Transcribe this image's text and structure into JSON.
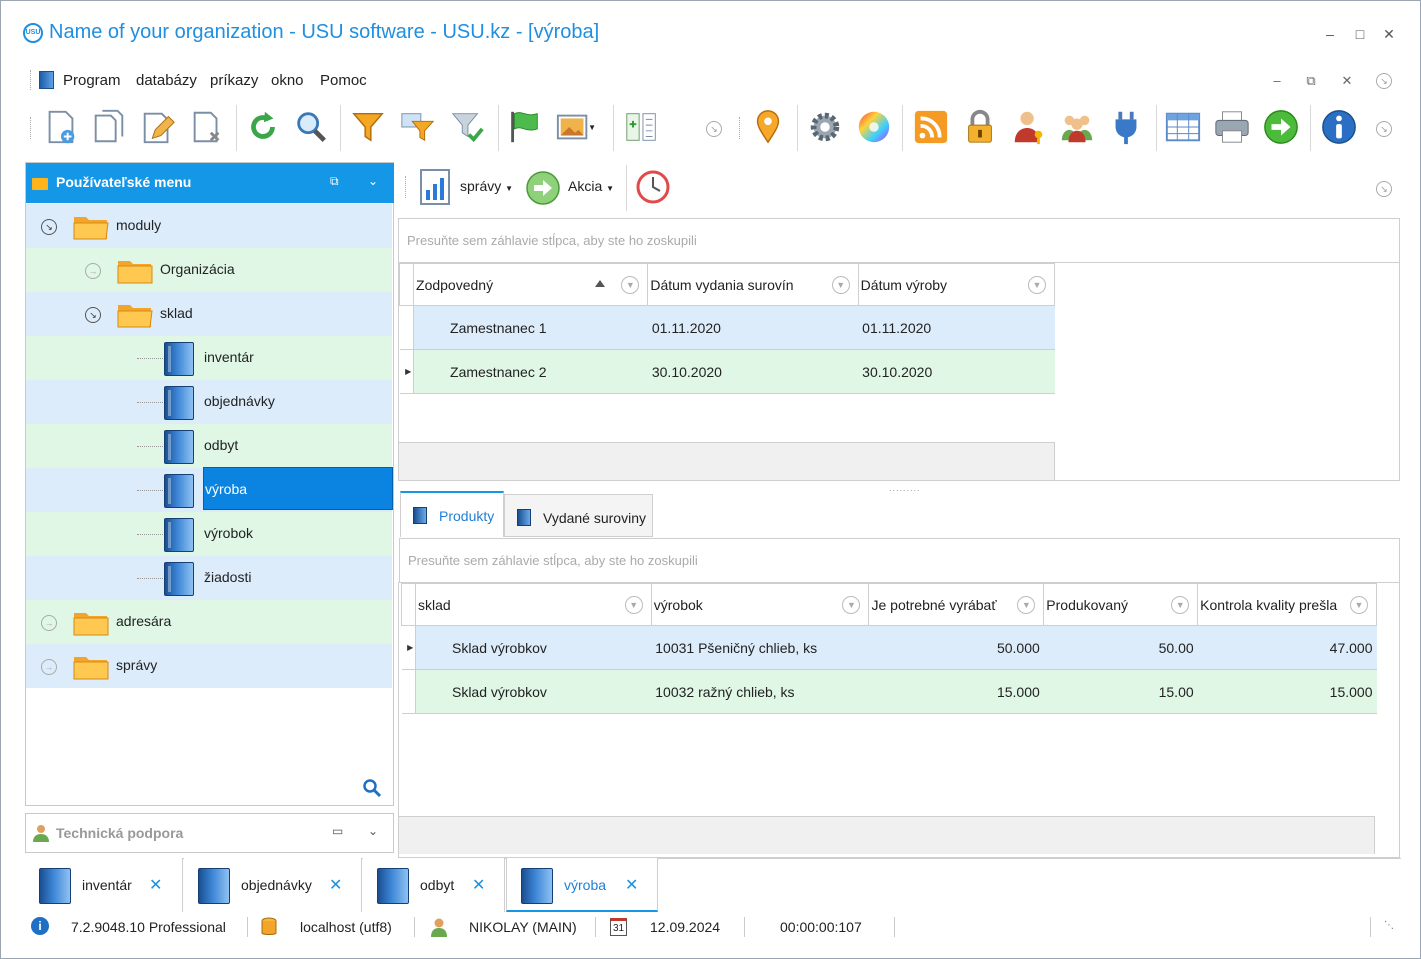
{
  "window": {
    "title": "Name of your organization - USU software - USU.kz - [výroba]",
    "logo_text": "USU",
    "accent": "#1597e8"
  },
  "menu": {
    "items": [
      "Program",
      "databázy",
      "príkazy",
      "okno",
      "Pomoc"
    ]
  },
  "toolbar": {
    "icons": [
      "add-document-icon",
      "copy-document-icon",
      "edit-icon",
      "delete-document-icon",
      "refresh-icon",
      "search-icon",
      "filter-icon",
      "filter-edit-icon",
      "filter-clear-icon",
      "flag-icon",
      "image-icon",
      "columns-icon",
      "map-pin-icon",
      "settings-icon",
      "color-wheel-icon",
      "rss-icon",
      "lock-icon",
      "user-key-icon",
      "users-icon",
      "plug-icon",
      "table-icon",
      "print-icon",
      "go-icon",
      "info-icon"
    ]
  },
  "sidebar": {
    "title": "Používateľské menu",
    "items": [
      {
        "label": "moduly"
      },
      {
        "label": "Organizácia"
      },
      {
        "label": "sklad"
      },
      {
        "label": "inventár"
      },
      {
        "label": "objednávky"
      },
      {
        "label": "odbyt"
      },
      {
        "label": "výroba"
      },
      {
        "label": "výrobok"
      },
      {
        "label": "žiadosti"
      },
      {
        "label": "adresára"
      },
      {
        "label": "správy"
      }
    ],
    "selected": "výroba"
  },
  "support_panel": {
    "title": "Technická podpora"
  },
  "main_toolbar": {
    "reports_label": "správy",
    "action_label": "Akcia"
  },
  "grid1": {
    "group_hint": "Presuňte sem záhlavie stĺpca, aby ste ho zoskupili",
    "columns": [
      "Zodpovedný",
      "Dátum vydania surovín",
      "Dátum výroby"
    ],
    "sort": "ascending",
    "rows": [
      [
        "Zamestnanec 1",
        "01.11.2020",
        "01.11.2020"
      ],
      [
        "Zamestnanec 2",
        "30.10.2020",
        "30.10.2020"
      ]
    ]
  },
  "detail_tabs": {
    "tabs": [
      "Produkty",
      "Vydané suroviny"
    ],
    "active": "Produkty"
  },
  "grid2": {
    "group_hint": "Presuňte sem záhlavie stĺpca, aby ste ho zoskupili",
    "columns": [
      "sklad",
      "výrobok",
      "Je potrebné vyrábať",
      "Produkovaný",
      "Kontrola kvality prešla"
    ],
    "rows": [
      [
        "Sklad výrobkov",
        "10031 Pšeničný chlieb, ks",
        "50.000",
        "50.00",
        "47.000"
      ],
      [
        "Sklad výrobkov",
        "10032 ražný chlieb, ks",
        "15.000",
        "15.00",
        "15.000"
      ]
    ]
  },
  "doc_tabs": {
    "tabs": [
      "inventár",
      "objednávky",
      "odbyt",
      "výroba"
    ],
    "active": "výroba",
    "close_glyph": "✕"
  },
  "status": {
    "version": "7.2.9048.10 Professional",
    "db": "localhost (utf8)",
    "user": "NIKOLAY (MAIN)",
    "calendar_day": "31",
    "date": "12.09.2024",
    "timer": "00:00:00:107"
  }
}
